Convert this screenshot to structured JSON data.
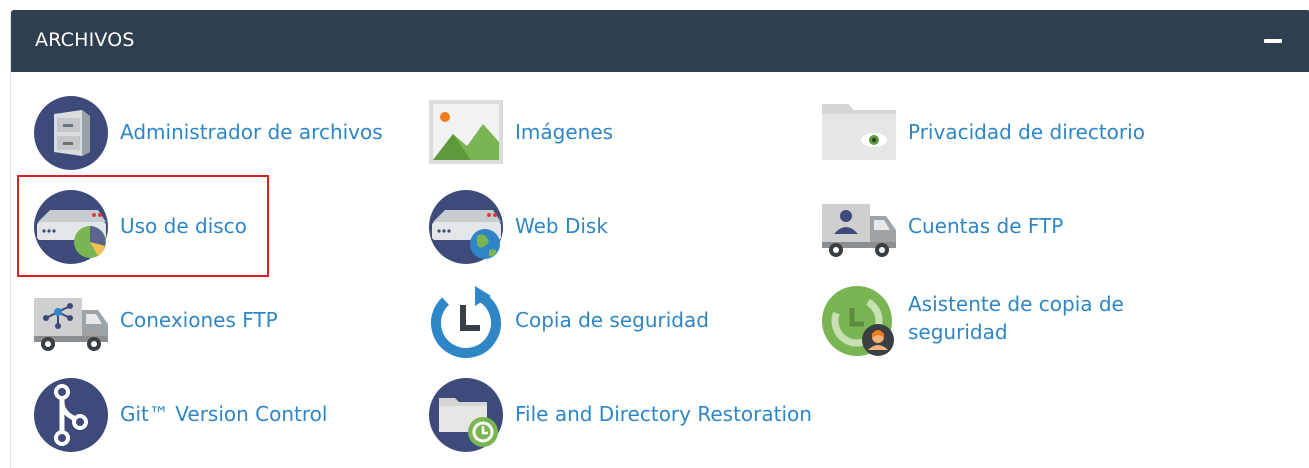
{
  "section": {
    "title": "ARCHIVOS",
    "collapse_symbol": "−"
  },
  "items": [
    {
      "id": "file-manager",
      "label": "Administrador de archivos",
      "icon": "file-cabinet-icon"
    },
    {
      "id": "images",
      "label": "Imágenes",
      "icon": "image-icon"
    },
    {
      "id": "directory-privacy",
      "label": "Privacidad de directorio",
      "icon": "folder-eye-icon"
    },
    {
      "id": "disk-usage",
      "label": "Uso de disco",
      "icon": "disk-usage-icon",
      "highlighted": true
    },
    {
      "id": "web-disk",
      "label": "Web Disk",
      "icon": "web-disk-icon"
    },
    {
      "id": "ftp-accounts",
      "label": "Cuentas de FTP",
      "icon": "ftp-accounts-truck-icon"
    },
    {
      "id": "ftp-connections",
      "label": "Conexiones FTP",
      "icon": "ftp-connections-truck-icon"
    },
    {
      "id": "backup",
      "label": "Copia de seguridad",
      "icon": "backup-clock-icon"
    },
    {
      "id": "backup-wizard",
      "label": "Asistente de copia de seguridad",
      "icon": "backup-wizard-icon"
    },
    {
      "id": "git",
      "label": "Git™ Version Control",
      "icon": "git-branch-icon"
    },
    {
      "id": "file-restoration",
      "label": "File and Directory Restoration",
      "icon": "folder-restore-icon"
    }
  ],
  "colors": {
    "header_bg": "#2f3f4f",
    "link": "#2f86c6",
    "highlight_border": "#e01c24",
    "icon_navy": "#3e4a7a",
    "icon_green": "#79b552"
  }
}
